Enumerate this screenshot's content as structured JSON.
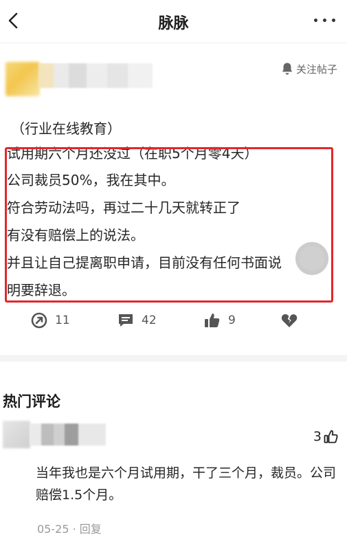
{
  "header": {
    "title": "脉脉"
  },
  "post": {
    "follow_label": "关注帖子",
    "lines": [
      "（行业在线教育）",
      "试用期六个月还没过（在职5个月零4天）",
      "公司裁员50%，我在其中。",
      "符合劳动法吗，再过二十几天就转正了",
      "有没有赔偿上的说法。",
      "并且让自己提离职申请，目前没有任何书面说",
      "明要辞退。"
    ]
  },
  "actions": {
    "share_count": "11",
    "comment_count": "42",
    "like_count": "9"
  },
  "comments_section": {
    "title": "热门评论",
    "comments": [
      {
        "like_count": "3",
        "text": "当年我也是六个月试用期，干了三个月，裁员。公司赔偿1.5个月。",
        "date": "05-25",
        "separator": "·",
        "reply_label": "回复"
      }
    ]
  },
  "colors": {
    "highlight": "#e0272b",
    "icon": "#555555"
  }
}
